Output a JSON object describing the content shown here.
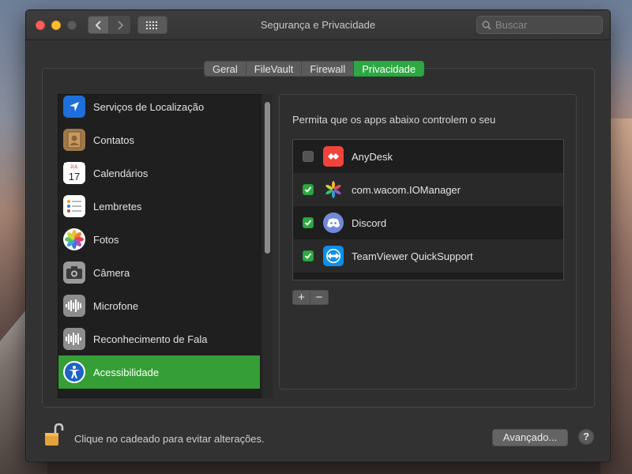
{
  "window": {
    "title": "Segurança e Privacidade"
  },
  "search": {
    "placeholder": "Buscar"
  },
  "tabs": [
    {
      "label": "Geral",
      "active": false
    },
    {
      "label": "FileVault",
      "active": false
    },
    {
      "label": "Firewall",
      "active": false
    },
    {
      "label": "Privacidade",
      "active": true
    }
  ],
  "sidebar": {
    "items": [
      {
        "label": "Serviços de Localização",
        "icon": "location-arrow-icon",
        "selected": false
      },
      {
        "label": "Contatos",
        "icon": "contacts-book-icon",
        "selected": false
      },
      {
        "label": "Calendários",
        "icon": "calendar-icon",
        "selected": false,
        "icon_month": "JUL",
        "icon_day": "17"
      },
      {
        "label": "Lembretes",
        "icon": "reminders-list-icon",
        "selected": false
      },
      {
        "label": "Fotos",
        "icon": "photos-flower-icon",
        "selected": false
      },
      {
        "label": "Câmera",
        "icon": "camera-icon",
        "selected": false
      },
      {
        "label": "Microfone",
        "icon": "microphone-waveform-icon",
        "selected": false
      },
      {
        "label": "Reconhecimento de Fala",
        "icon": "speech-waveform-icon",
        "selected": false
      },
      {
        "label": "Acessibilidade",
        "icon": "accessibility-person-icon",
        "selected": true
      }
    ]
  },
  "main": {
    "description": "Permita que os apps abaixo controlem o seu",
    "apps": [
      {
        "name": "AnyDesk",
        "checked": false,
        "icon": "anydesk-icon"
      },
      {
        "name": "com.wacom.IOManager",
        "checked": true,
        "icon": "wacom-icon"
      },
      {
        "name": "Discord",
        "checked": true,
        "icon": "discord-icon"
      },
      {
        "name": "TeamViewer QuickSupport",
        "checked": true,
        "icon": "teamviewer-icon"
      }
    ],
    "add_label": "+",
    "remove_label": "−"
  },
  "footer": {
    "lock_text": "Clique no cadeado para evitar alterações.",
    "advanced_label": "Avançado...",
    "help_label": "?"
  },
  "colors": {
    "accent_green": "#2ea843",
    "selection_green": "#369e36",
    "window_bg": "#323232"
  }
}
